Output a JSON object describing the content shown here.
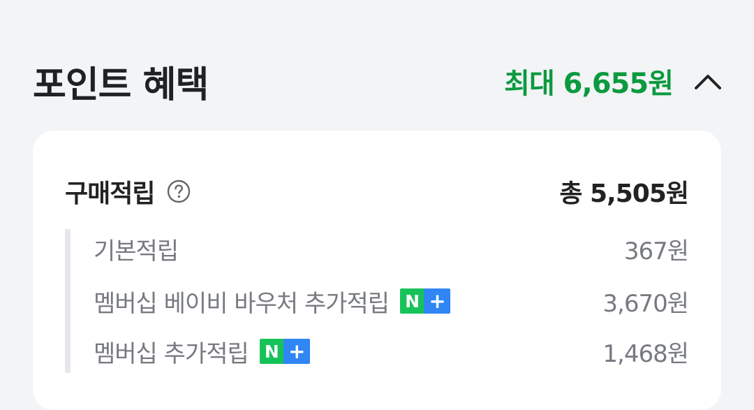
{
  "header": {
    "title": "포인트 혜택",
    "max_points": "최대 6,655원",
    "accent_color": "#0b9a3f",
    "toggle_icon": "chevron-up-icon"
  },
  "purchase": {
    "label": "구매적립",
    "help_icon": "question-circle-icon",
    "total": "총 5,505원"
  },
  "rows": [
    {
      "label": "기본적립",
      "value": "367원"
    },
    {
      "label": "멤버십 베이비 바우처 추가적립",
      "value": "3,670원",
      "badge": {
        "n": "N",
        "plus": "+"
      }
    },
    {
      "label": "멤버십 추가적립",
      "value": "1,468원",
      "badge": {
        "n": "N",
        "plus": "+"
      }
    }
  ]
}
